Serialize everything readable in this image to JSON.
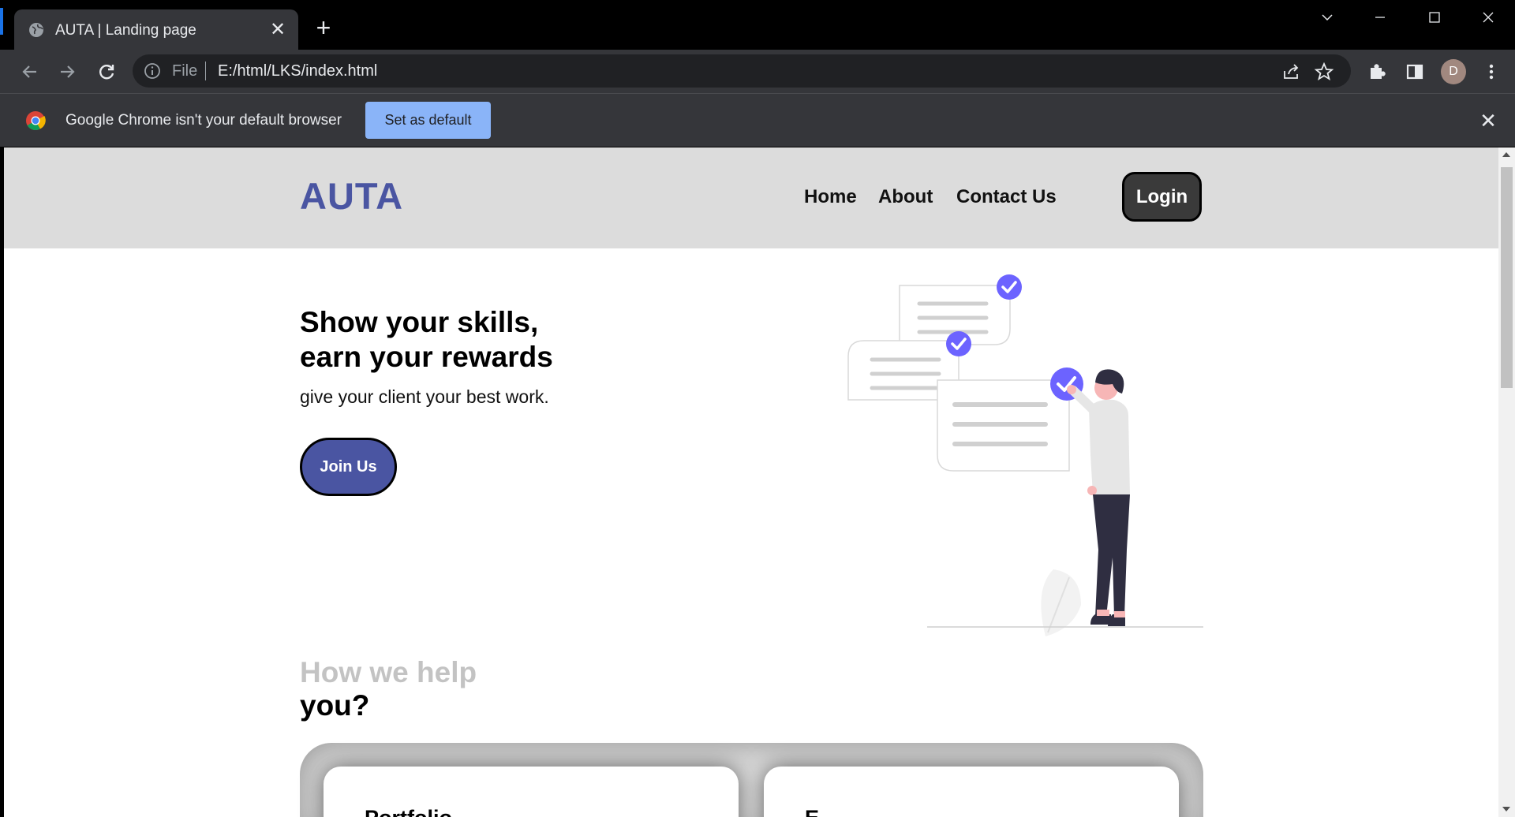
{
  "browser": {
    "tab_title": "AUTA | Landing page",
    "omnibox_scheme": "File",
    "url": "E:/html/LKS/index.html",
    "avatar_initial": "D",
    "infobar_message": "Google Chrome isn't your default browser",
    "infobar_button": "Set as default"
  },
  "site": {
    "brand": "AUTA",
    "brand_color": "#4a55a2",
    "nav": [
      "Home",
      "About",
      "Contact Us"
    ],
    "login": "Login"
  },
  "hero": {
    "title_line1": "Show your skills,",
    "title_line2": "earn your rewards",
    "subtitle": "give your client your best work.",
    "cta": "Join Us"
  },
  "help": {
    "title_muted": "How we help",
    "title_strong": "you?",
    "cards": [
      "Portfolio",
      "E"
    ]
  },
  "colors": {
    "accent_purple": "#6c63ff",
    "header_bg": "#dcdcdc",
    "chrome_dark": "#35363a"
  }
}
